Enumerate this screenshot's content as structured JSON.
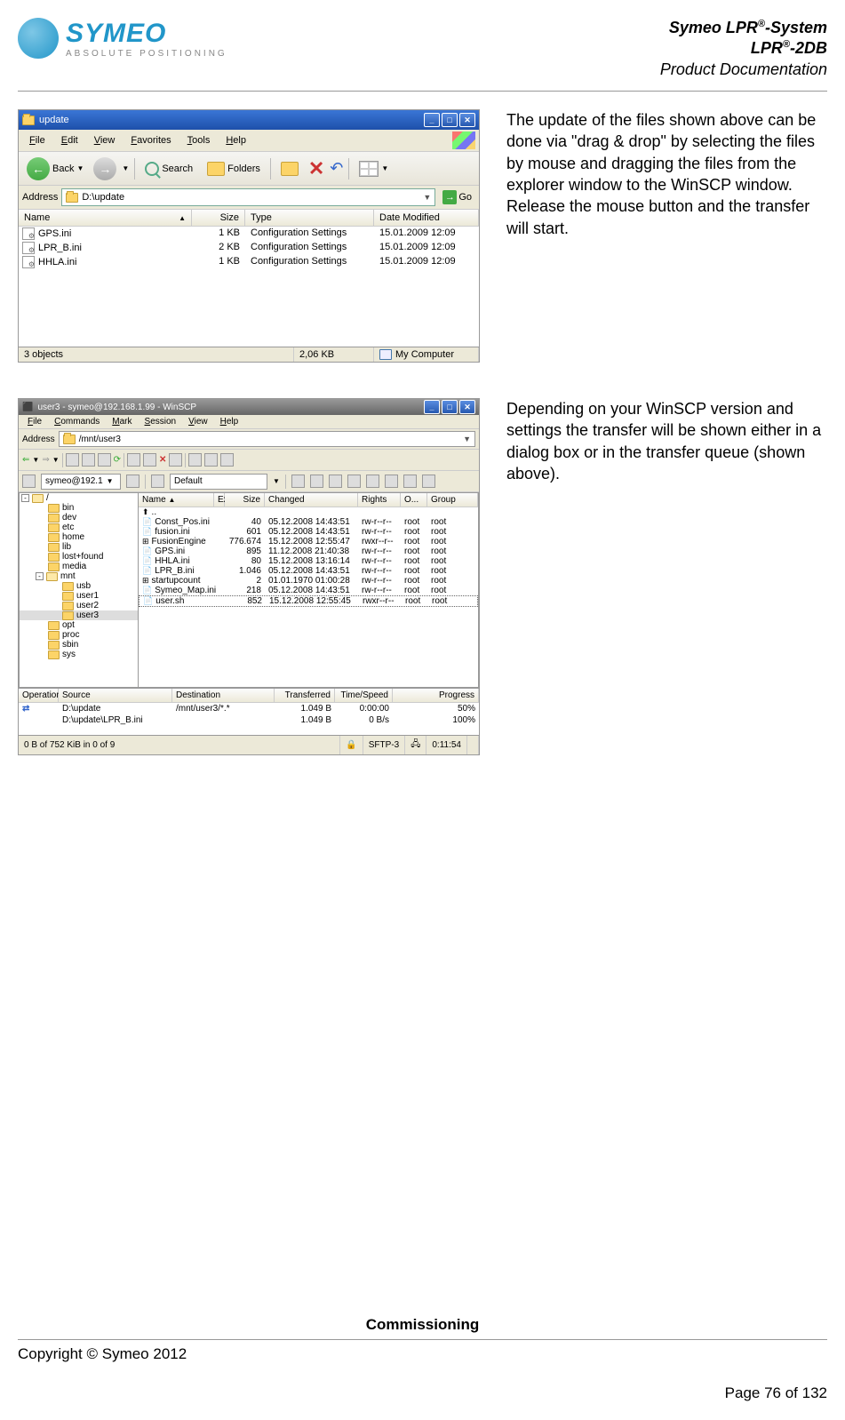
{
  "header": {
    "logo_name": "SYMEO",
    "logo_tagline": "ABSOLUTE POSITIONING",
    "line1_a": "Symeo LPR",
    "line1_b": "-System",
    "line2_a": "LPR",
    "line2_b": "-2DB",
    "line3": "Product Documentation"
  },
  "section1": {
    "text": "The update of the files shown above can be done via \"drag & drop\" by selecting the files by mouse and dragging the files from the explorer window to the WinSCP window. Release the mouse button and the transfer will start.",
    "explorer": {
      "title": "update",
      "menu": [
        "File",
        "Edit",
        "View",
        "Favorites",
        "Tools",
        "Help"
      ],
      "back_label": "Back",
      "search_label": "Search",
      "folders_label": "Folders",
      "address_label": "Address",
      "address_value": "D:\\update",
      "go_label": "Go",
      "headers": {
        "name": "Name",
        "size": "Size",
        "type": "Type",
        "date": "Date Modified"
      },
      "files": [
        {
          "name": "GPS.ini",
          "size": "1 KB",
          "type": "Configuration Settings",
          "date": "15.01.2009 12:09"
        },
        {
          "name": "LPR_B.ini",
          "size": "2 KB",
          "type": "Configuration Settings",
          "date": "15.01.2009 12:09"
        },
        {
          "name": "HHLA.ini",
          "size": "1 KB",
          "type": "Configuration Settings",
          "date": "15.01.2009 12:09"
        }
      ],
      "status": {
        "objects": "3 objects",
        "size": "2,06 KB",
        "location": "My Computer"
      }
    }
  },
  "section2": {
    "text": "Depending on your WinSCP version and settings the transfer will be shown either in a dialog box or in the transfer queue (shown above).",
    "winscp": {
      "title": "user3 - symeo@192.168.1.99 - WinSCP",
      "menu": [
        "File",
        "Commands",
        "Mark",
        "Session",
        "View",
        "Help"
      ],
      "address_label": "Address",
      "address_value": "/mnt/user3",
      "session_combo": "symeo@192.1",
      "default_label": "Default",
      "tree": [
        {
          "label": "/ <root>",
          "indent": 0,
          "expand": "-",
          "open": true
        },
        {
          "label": "bin",
          "indent": 1
        },
        {
          "label": "dev",
          "indent": 1
        },
        {
          "label": "etc",
          "indent": 1
        },
        {
          "label": "home",
          "indent": 1
        },
        {
          "label": "lib",
          "indent": 1
        },
        {
          "label": "lost+found",
          "indent": 1
        },
        {
          "label": "media",
          "indent": 1
        },
        {
          "label": "mnt",
          "indent": 1,
          "expand": "-",
          "open": true
        },
        {
          "label": "usb",
          "indent": 2
        },
        {
          "label": "user1",
          "indent": 2
        },
        {
          "label": "user2",
          "indent": 2
        },
        {
          "label": "user3",
          "indent": 2,
          "selected": true
        },
        {
          "label": "opt",
          "indent": 1
        },
        {
          "label": "proc",
          "indent": 1
        },
        {
          "label": "sbin",
          "indent": 1
        },
        {
          "label": "sys",
          "indent": 1
        }
      ],
      "file_headers": {
        "name": "Name",
        "ext": "Ext",
        "size": "Size",
        "changed": "Changed",
        "rights": "Rights",
        "owner": "O...",
        "group": "Group"
      },
      "files": [
        {
          "name": "..",
          "size": "",
          "changed": "",
          "rights": "",
          "owner": "",
          "group": "",
          "icon": "up"
        },
        {
          "name": "Const_Pos.ini",
          "size": "40",
          "changed": "05.12.2008 14:43:51",
          "rights": "rw-r--r--",
          "owner": "root",
          "group": "root"
        },
        {
          "name": "fusion.ini",
          "size": "601",
          "changed": "05.12.2008 14:43:51",
          "rights": "rw-r--r--",
          "owner": "root",
          "group": "root"
        },
        {
          "name": "FusionEngine",
          "size": "776.674",
          "changed": "15.12.2008 12:55:47",
          "rights": "rwxr--r--",
          "owner": "root",
          "group": "root",
          "icon": "exe"
        },
        {
          "name": "GPS.ini",
          "size": "895",
          "changed": "11.12.2008 21:40:38",
          "rights": "rw-r--r--",
          "owner": "root",
          "group": "root"
        },
        {
          "name": "HHLA.ini",
          "size": "80",
          "changed": "15.12.2008 13:16:14",
          "rights": "rw-r--r--",
          "owner": "root",
          "group": "root"
        },
        {
          "name": "LPR_B.ini",
          "size": "1.046",
          "changed": "05.12.2008 14:43:51",
          "rights": "rw-r--r--",
          "owner": "root",
          "group": "root"
        },
        {
          "name": "startupcount",
          "size": "2",
          "changed": "01.01.1970 01:00:28",
          "rights": "rw-r--r--",
          "owner": "root",
          "group": "root",
          "icon": "exe"
        },
        {
          "name": "Symeo_Map.ini",
          "size": "218",
          "changed": "05.12.2008 14:43:51",
          "rights": "rw-r--r--",
          "owner": "root",
          "group": "root"
        },
        {
          "name": "user.sh",
          "size": "852",
          "changed": "15.12.2008 12:55:45",
          "rights": "rwxr--r--",
          "owner": "root",
          "group": "root",
          "selected": true
        }
      ],
      "queue_headers": {
        "op": "Operation",
        "src": "Source",
        "dst": "Destination",
        "trans": "Transferred",
        "time": "Time/Speed",
        "prog": "Progress"
      },
      "queue": [
        {
          "op": "⇄",
          "src": "D:\\update",
          "dst": "/mnt/user3/*.*",
          "trans": "1.049 B",
          "time": "0:00:00",
          "prog": "50%"
        },
        {
          "op": "",
          "src": "D:\\update\\LPR_B.ini",
          "dst": "",
          "trans": "1.049 B",
          "time": "0 B/s",
          "prog": "100%"
        }
      ],
      "status": {
        "selection": "0 B of 752 KiB in 0 of 9",
        "protocol": "SFTP-3",
        "time": "0:11:54"
      }
    }
  },
  "footer": {
    "section": "Commissioning",
    "copyright": "Copyright © Symeo 2012",
    "page": "Page 76 of 132"
  }
}
